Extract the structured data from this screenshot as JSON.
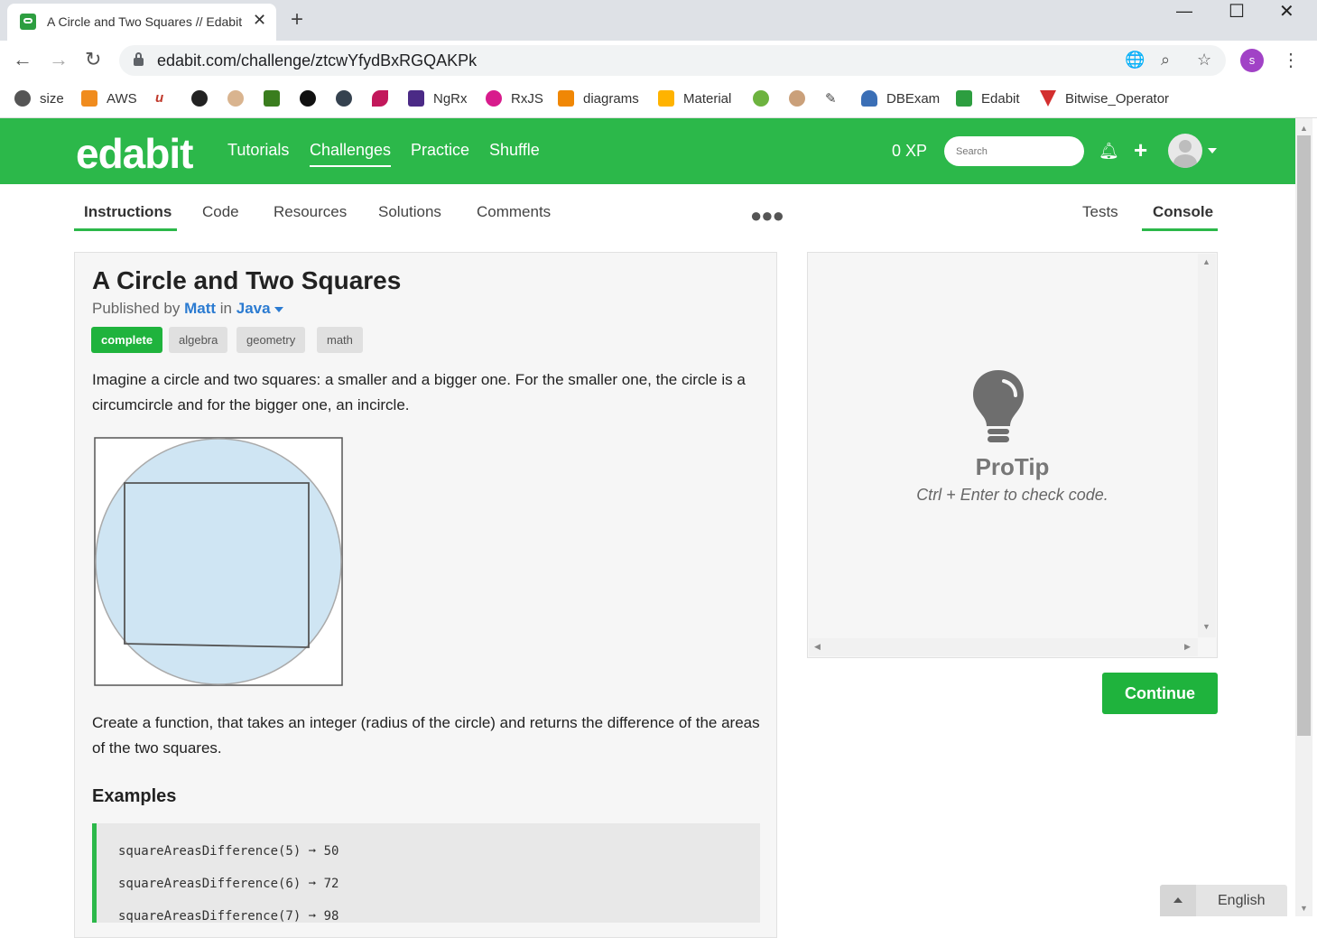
{
  "browser": {
    "tab_title": "A Circle and Two Squares // Edabit",
    "url": "edabit.com/challenge/ztcwYfydBxRGQAKPk",
    "profile_initial": "s",
    "bookmarks": [
      "size",
      "AWS",
      "NgRx",
      "RxJS",
      "diagrams",
      "Material",
      "DBExam",
      "Edabit",
      "Bitwise_Operator"
    ]
  },
  "header": {
    "logo": "edabit",
    "nav": [
      "Tutorials",
      "Challenges",
      "Practice",
      "Shuffle"
    ],
    "active_nav": "Challenges",
    "xp": "0 XP",
    "search_placeholder": "Search"
  },
  "content_tabs": {
    "left": [
      "Instructions",
      "Code",
      "Resources",
      "Solutions",
      "Comments"
    ],
    "right": [
      "Tests",
      "Console"
    ],
    "active_left": "Instructions",
    "active_right": "Console"
  },
  "challenge": {
    "title": "A Circle and Two Squares",
    "published_prefix": "Published by",
    "author": "Matt",
    "in_word": "in",
    "language": "Java",
    "tags": [
      "complete",
      "algebra",
      "geometry",
      "math"
    ],
    "intro": "Imagine a circle and two squares: a smaller and a bigger one. For the smaller one, the circle is a circumcircle and for the bigger one, an incircle.",
    "task": "Create a function, that takes an integer (radius of the circle) and returns the difference of the areas of the two squares.",
    "examples_heading": "Examples",
    "examples": [
      "squareAreasDifference(5) ➞ 50",
      "squareAreasDifference(6) ➞ 72",
      "squareAreasDifference(7) ➞ 98"
    ]
  },
  "console": {
    "protip_title": "ProTip",
    "protip_text": "Ctrl + Enter to check code.",
    "continue_label": "Continue"
  },
  "language_widget": "English",
  "colors": {
    "brand_green": "#2cb84a",
    "link_blue": "#2b7bd1",
    "circle_fill": "#cfe5f3"
  }
}
